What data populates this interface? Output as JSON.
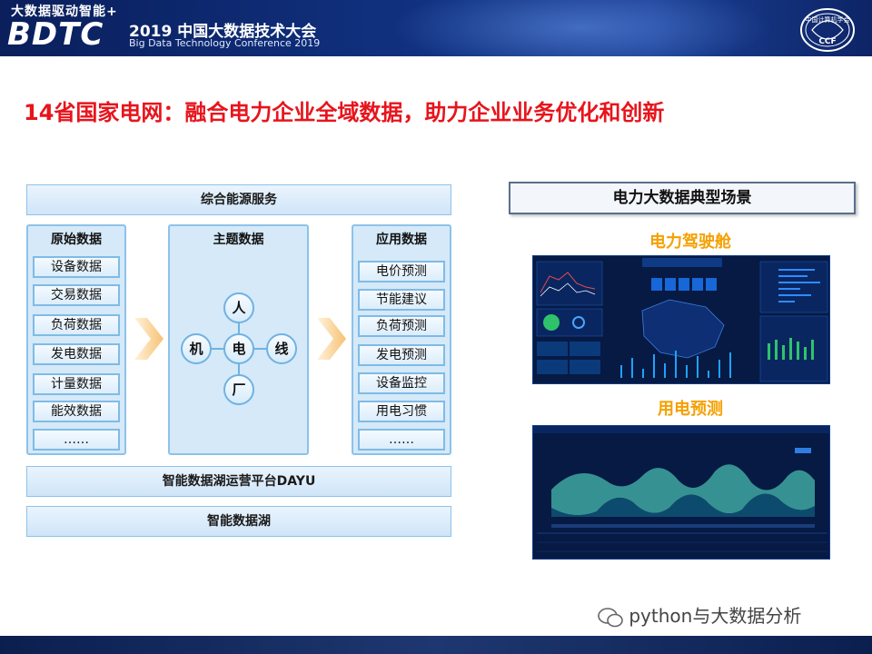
{
  "header": {
    "slogan": "大数据驱动智能+",
    "brand": "BDTC",
    "conference_cn": "2019 中国大数据技术大会",
    "conference_en": "Big Data Technology Conference 2019",
    "logo_text_top": "中国计算机学会",
    "logo_text_bottom": "CCF"
  },
  "title": "14省国家电网：融合电力企业全域数据，助力企业业务优化和创新",
  "diagram": {
    "top_bar": "综合能源服务",
    "raw_data": {
      "title": "原始数据",
      "items": [
        "设备数据",
        "交易数据",
        "负荷数据",
        "发电数据",
        "计量数据",
        "能效数据",
        "……"
      ]
    },
    "topic_data": {
      "title": "主题数据",
      "nodes": {
        "top": "人",
        "left": "机",
        "center": "电",
        "right": "线",
        "bottom": "厂"
      }
    },
    "app_data": {
      "title": "应用数据",
      "items": [
        "电价预测",
        "节能建议",
        "负荷预测",
        "发电预测",
        "设备监控",
        "用电习惯",
        "……"
      ]
    },
    "platform_bar": "智能数据湖运营平台DAYU",
    "lake_bar": "智能数据湖"
  },
  "scenarios": {
    "title": "电力大数据典型场景",
    "scene1_label": "电力驾驶舱",
    "scene2_label": "用电预测"
  },
  "watermark": "python与大数据分析",
  "colors": {
    "title_red": "#e8141c",
    "accent_orange": "#f5a000",
    "panel_blue": "#cfe5f8",
    "banner_navy": "#10307e"
  }
}
